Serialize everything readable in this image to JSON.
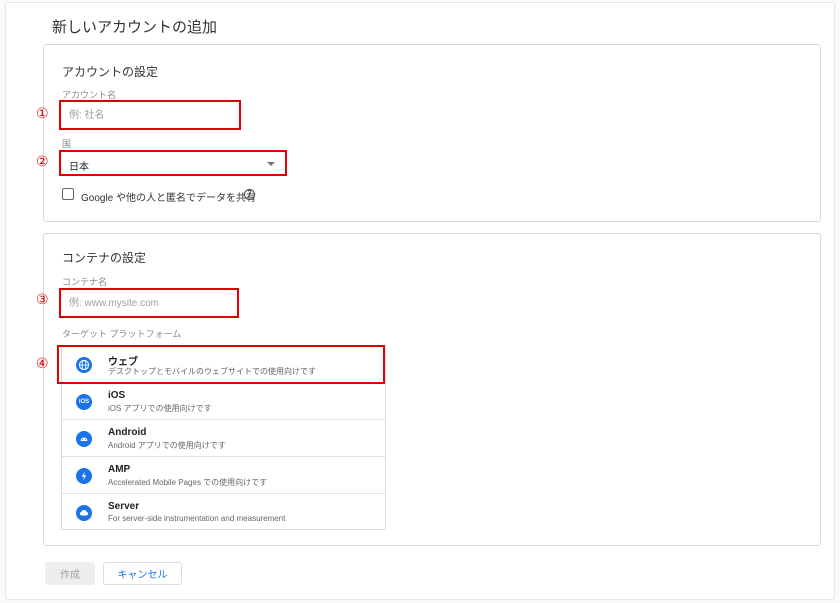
{
  "page": {
    "title": "新しいアカウントの追加"
  },
  "account_settings": {
    "title": "アカウントの設定",
    "account_name_label": "アカウント名",
    "account_name_placeholder": "例: 社名",
    "country_label": "国",
    "country_value": "日本",
    "share_label": "Google や他の人と匿名でデータを共有",
    "share_checked": false
  },
  "container_settings": {
    "title": "コンテナの設定",
    "container_name_label": "コンテナ名",
    "container_name_placeholder": "例: www.mysite.com",
    "platform_label": "ターゲット プラットフォーム",
    "platforms": [
      {
        "name": "ウェブ",
        "desc": "デスクトップとモバイルのウェブサイトでの使用向けです",
        "icon": "globe-icon"
      },
      {
        "name": "iOS",
        "desc": "iOS アプリでの使用向けです",
        "icon": "ios-icon"
      },
      {
        "name": "Android",
        "desc": "Android アプリでの使用向けです",
        "icon": "android-icon"
      },
      {
        "name": "AMP",
        "desc": "Accelerated Mobile Pages での使用向けです",
        "icon": "amp-lightning-icon"
      },
      {
        "name": "Server",
        "desc": "For server-side instrumentation and measurement",
        "icon": "cloud-icon"
      }
    ]
  },
  "annotations": {
    "n1": "①",
    "n2": "②",
    "n3": "③",
    "n4": "④"
  },
  "actions": {
    "create_label": "作成",
    "cancel_label": "キャンセル"
  },
  "colors": {
    "accent": "#1a73e8",
    "annotation_red": "#e00000"
  }
}
